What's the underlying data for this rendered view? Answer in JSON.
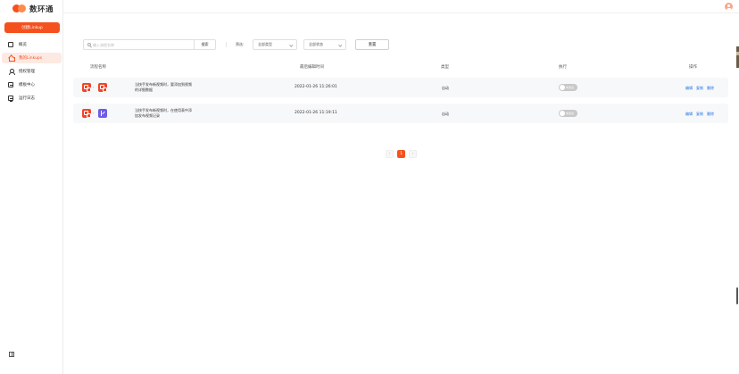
{
  "app": {
    "logo_text": "数环通",
    "create_button": "创建Linkup"
  },
  "sidebar": {
    "items": [
      {
        "label": "概览",
        "icon": "grid-icon",
        "active": false
      },
      {
        "label": "我的Linkups",
        "icon": "home-icon",
        "active": true
      },
      {
        "label": "授权管理",
        "icon": "user-icon",
        "active": false
      },
      {
        "label": "模板中心",
        "icon": "template-icon",
        "active": false
      },
      {
        "label": "运行日志",
        "icon": "log-icon",
        "active": false
      }
    ],
    "collapse_icon": "collapse-icon"
  },
  "filters": {
    "search_placeholder": "输入流程名称",
    "search_button": "搜索",
    "filter_label": "筛选:",
    "type_select": "全部类型",
    "status_select": "全部状态",
    "reset_button": "重置"
  },
  "table": {
    "headers": {
      "name": "流程名称",
      "edited": "最后编辑时间",
      "type": "类型",
      "run": "执行",
      "actions": "操作"
    },
    "rows": [
      {
        "app_from": "red-app-icon",
        "app_to": "red-app-icon",
        "description": "当快手发布新视频时，要添加到视频的详细数据",
        "edited": "2022-01-26 11:26:01",
        "type": "自动",
        "toggle_label": "未激活",
        "actions": [
          "编辑",
          "复制",
          "删除"
        ]
      },
      {
        "app_from": "red-app-icon",
        "app_to": "purple-app-icon",
        "description": "当快手发布新视频时，在使用表中添加发布视频记录",
        "edited": "2022-01-26 11:19:11",
        "type": "自动",
        "toggle_label": "未激活",
        "actions": [
          "编辑",
          "复制",
          "删除"
        ]
      }
    ]
  },
  "pagination": {
    "prev": "‹",
    "current": "1",
    "next": "›"
  },
  "colors": {
    "brand": "#f5511e",
    "link": "#1a73e8",
    "active_bg": "#fde9e2"
  }
}
